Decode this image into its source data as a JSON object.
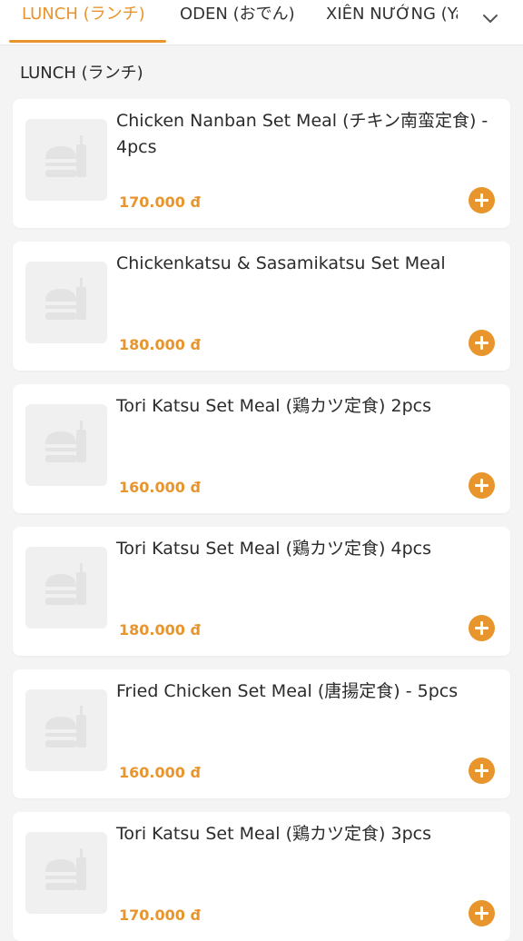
{
  "tabs": [
    {
      "label": "LUNCH (ランチ)",
      "active": true
    },
    {
      "label": "ODEN (おでん)",
      "active": false
    },
    {
      "label": "XIÊN NƯỚNG (Ya",
      "active": false
    }
  ],
  "tab_more_icon": "chevron-down-icon",
  "section": {
    "title": "LUNCH (ランチ)"
  },
  "items": [
    {
      "name": "Chicken Nanban Set Meal (チキン南蛮定食) - 4pcs",
      "price": "170.000 đ"
    },
    {
      "name": "Chickenkatsu & Sasamikatsu Set Meal",
      "price": "180.000 đ"
    },
    {
      "name": "Tori Katsu Set Meal (鶏カツ定食) 2pcs",
      "price": "160.000 đ"
    },
    {
      "name": "Tori Katsu Set Meal (鶏カツ定食) 4pcs",
      "price": "180.000 đ"
    },
    {
      "name": "Fried Chicken Set Meal (唐揚定食) - 5pcs",
      "price": "160.000 đ"
    },
    {
      "name": "Tori Katsu Set Meal (鶏カツ定食) 3pcs",
      "price": "170.000 đ"
    }
  ],
  "colors": {
    "accent": "#e8952d",
    "background": "#f4f4f4",
    "card": "#ffffff"
  }
}
